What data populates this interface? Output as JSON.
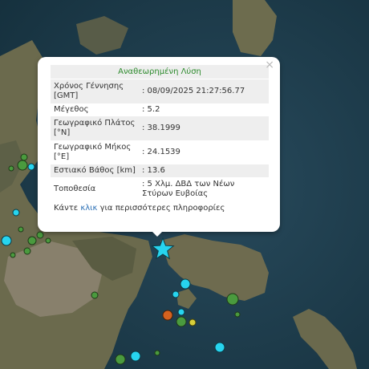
{
  "popup": {
    "header": "Αναθεωρημένη Λύση",
    "close": "×",
    "rows": [
      {
        "label": "Χρόνος Γέννησης [GMT]",
        "value": ": 08/09/2025 21:27:56.77"
      },
      {
        "label": "Μέγεθος",
        "value": ": 5.2"
      },
      {
        "label": "Γεωγραφικό Πλάτος [°N]",
        "value": ": 38.1999"
      },
      {
        "label": "Γεωγραφικό Μήκος [°E]",
        "value": ": 24.1539"
      },
      {
        "label": "Εστιακό Βάθος [km]",
        "value": ": 13.6"
      },
      {
        "label": "Τοποθεσία",
        "value": ": 5 Χλμ. ΔΒΔ των Νέων Στύρων Ευβοίας"
      }
    ],
    "more_prefix": "Κάντε ",
    "more_link": "κλικ",
    "more_suffix": " για περισσότερες πληροφορίες"
  },
  "colors": {
    "sea": "#1f3b4a",
    "land": "#6e6d50",
    "popup_header": "#2e8b2e",
    "link": "#2a6fb5",
    "marker_cyan": "#27d4ef",
    "marker_green": "#4a9a3e",
    "marker_orange": "#d4621f",
    "marker_yellow": "#d8cf3a"
  },
  "markers": [
    {
      "type": "star",
      "color": "cyan",
      "label": "main-event-star-icon"
    },
    {
      "type": "circle",
      "color": "cyan"
    },
    {
      "type": "circle",
      "color": "green"
    },
    {
      "type": "circle",
      "color": "orange"
    },
    {
      "type": "circle",
      "color": "yellow"
    }
  ]
}
